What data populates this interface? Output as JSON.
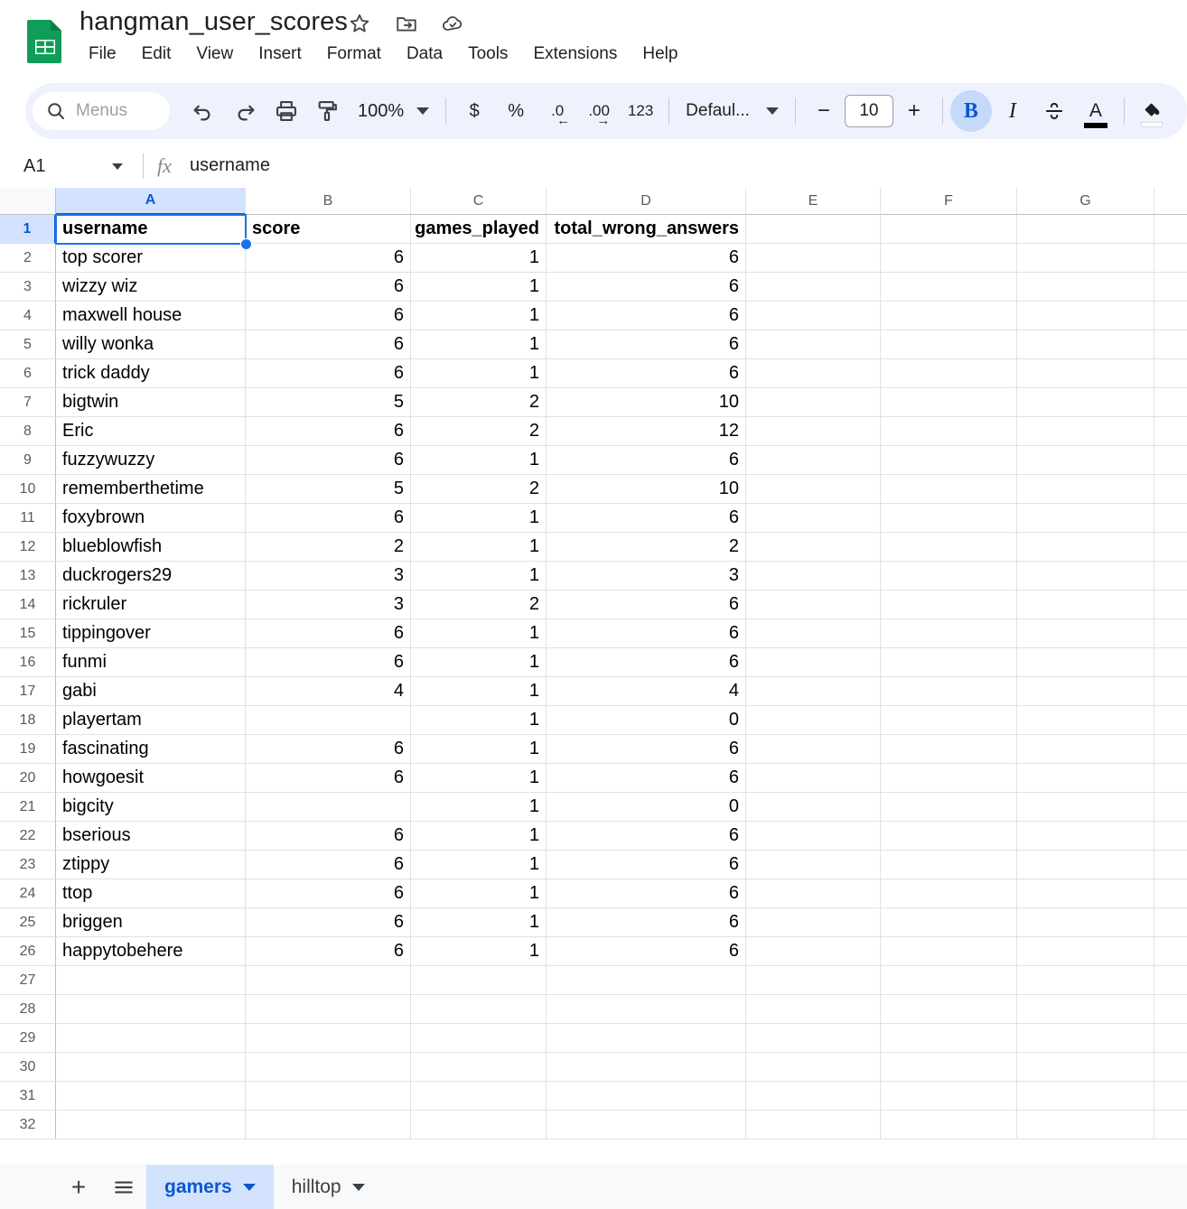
{
  "document": {
    "title": "hangman_user_scores",
    "icons": [
      "star-icon",
      "move-to-folder-icon",
      "cloud-saved-icon"
    ]
  },
  "menubar": {
    "items": [
      "File",
      "Edit",
      "View",
      "Insert",
      "Format",
      "Data",
      "Tools",
      "Extensions",
      "Help"
    ]
  },
  "toolbar": {
    "search_placeholder": "Menus",
    "undo": "undo-icon",
    "redo": "redo-icon",
    "print": "print-icon",
    "paint_format": "paint-format-icon",
    "zoom": "100%",
    "currency": "$",
    "percent": "%",
    "decrease_decimal": ".0",
    "increase_decimal": ".00",
    "more_formats": "123",
    "font_family": "Defaul...",
    "font_decrease": "−",
    "font_size": "10",
    "font_increase": "+",
    "bold": "B",
    "italic": "I",
    "strikethrough": "S",
    "text_color": "A",
    "fill_color": "fill-color-icon"
  },
  "formula_bar": {
    "name_box": "A1",
    "fx": "fx",
    "content": "username"
  },
  "grid": {
    "column_headers": [
      "A",
      "B",
      "C",
      "D",
      "E",
      "F",
      "G"
    ],
    "selected_column": "A",
    "selected_row": "1",
    "selected_cell": "A1",
    "row_numbers": [
      1,
      2,
      3,
      4,
      5,
      6,
      7,
      8,
      9,
      10,
      11,
      12,
      13,
      14,
      15,
      16,
      17,
      18,
      19,
      20,
      21,
      22,
      23,
      24,
      25,
      26,
      27,
      28,
      29,
      30,
      31,
      32
    ],
    "headers": [
      "username",
      "score",
      "games_played",
      "total_wrong_answers"
    ],
    "rows": [
      {
        "username": "top scorer",
        "score": "6",
        "games_played": "1",
        "total_wrong_answers": "6"
      },
      {
        "username": "wizzy wiz",
        "score": "6",
        "games_played": "1",
        "total_wrong_answers": "6"
      },
      {
        "username": "maxwell house",
        "score": "6",
        "games_played": "1",
        "total_wrong_answers": "6"
      },
      {
        "username": "willy wonka",
        "score": "6",
        "games_played": "1",
        "total_wrong_answers": "6"
      },
      {
        "username": "trick daddy",
        "score": "6",
        "games_played": "1",
        "total_wrong_answers": "6"
      },
      {
        "username": "bigtwin",
        "score": "5",
        "games_played": "2",
        "total_wrong_answers": "10"
      },
      {
        "username": "Eric",
        "score": "6",
        "games_played": "2",
        "total_wrong_answers": "12"
      },
      {
        "username": "fuzzywuzzy",
        "score": "6",
        "games_played": "1",
        "total_wrong_answers": "6"
      },
      {
        "username": "rememberthetime",
        "score": "5",
        "games_played": "2",
        "total_wrong_answers": "10"
      },
      {
        "username": "foxybrown",
        "score": "6",
        "games_played": "1",
        "total_wrong_answers": "6"
      },
      {
        "username": "blueblowfish",
        "score": "2",
        "games_played": "1",
        "total_wrong_answers": "2"
      },
      {
        "username": "duckrogers29",
        "score": "3",
        "games_played": "1",
        "total_wrong_answers": "3"
      },
      {
        "username": "rickruler",
        "score": "3",
        "games_played": "2",
        "total_wrong_answers": "6"
      },
      {
        "username": "tippingover",
        "score": "6",
        "games_played": "1",
        "total_wrong_answers": "6"
      },
      {
        "username": "funmi",
        "score": "6",
        "games_played": "1",
        "total_wrong_answers": "6"
      },
      {
        "username": "gabi",
        "score": "4",
        "games_played": "1",
        "total_wrong_answers": "4"
      },
      {
        "username": "playertam",
        "score": "",
        "games_played": "1",
        "total_wrong_answers": "0"
      },
      {
        "username": "fascinating",
        "score": "6",
        "games_played": "1",
        "total_wrong_answers": "6"
      },
      {
        "username": "howgoesit",
        "score": "6",
        "games_played": "1",
        "total_wrong_answers": "6"
      },
      {
        "username": "bigcity",
        "score": "",
        "games_played": "1",
        "total_wrong_answers": "0"
      },
      {
        "username": "bserious",
        "score": "6",
        "games_played": "1",
        "total_wrong_answers": "6"
      },
      {
        "username": "ztippy",
        "score": "6",
        "games_played": "1",
        "total_wrong_answers": "6"
      },
      {
        "username": "ttop",
        "score": "6",
        "games_played": "1",
        "total_wrong_answers": "6"
      },
      {
        "username": "briggen",
        "score": "6",
        "games_played": "1",
        "total_wrong_answers": "6"
      },
      {
        "username": "happytobehere",
        "score": "6",
        "games_played": "1",
        "total_wrong_answers": "6"
      }
    ]
  },
  "sheet_bar": {
    "add_sheet": "+",
    "all_sheets": "all-sheets-icon",
    "tabs": [
      {
        "label": "gamers",
        "active": true
      },
      {
        "label": "hilltop",
        "active": false
      }
    ]
  },
  "colors": {
    "brand_green": "#0f9d58",
    "accent_blue": "#1a73e8",
    "selected_header_bg": "#d3e3fd",
    "toolbar_bg": "#edf2fc"
  }
}
